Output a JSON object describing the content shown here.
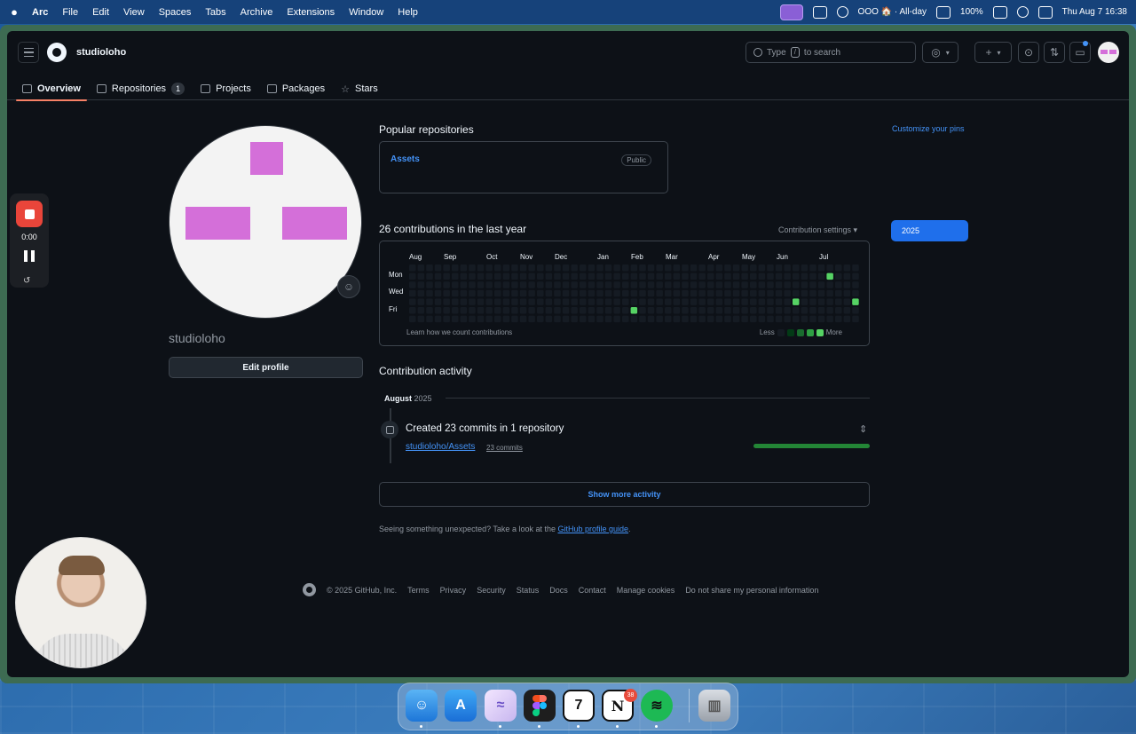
{
  "menubar": {
    "items": [
      "Arc",
      "File",
      "Edit",
      "View",
      "Spaces",
      "Tabs",
      "Archive",
      "Extensions",
      "Window",
      "Help"
    ],
    "status": "OOO 🏠 · All-day",
    "battery": "100%",
    "datetime": "Thu Aug 7  16:38"
  },
  "header": {
    "username": "studioloho",
    "search_prefix": "Type",
    "search_key": "/",
    "search_suffix": "to search",
    "plus": "+",
    "caret": "▾"
  },
  "tabs": [
    {
      "label": "Overview"
    },
    {
      "label": "Repositories",
      "count": "1"
    },
    {
      "label": "Projects"
    },
    {
      "label": "Packages"
    },
    {
      "label": "Stars"
    }
  ],
  "profile": {
    "name": "studioloho",
    "edit_label": "Edit profile",
    "emoji": "☺"
  },
  "popular": {
    "heading": "Popular repositories",
    "customize": "Customize your pins",
    "repo_name": "Assets",
    "repo_badge": "Public"
  },
  "contributions": {
    "title": "26 contributions in the last year",
    "settings": "Contribution settings ▾",
    "year": "2025",
    "months": [
      "Aug",
      "Sep",
      "Oct",
      "Nov",
      "Dec",
      "Jan",
      "Feb",
      "Mar",
      "Apr",
      "May",
      "Jun",
      "Jul"
    ],
    "days": [
      "Mon",
      "Wed",
      "Fri"
    ],
    "learn": "Learn how we count contributions",
    "less": "Less",
    "more": "More",
    "weeks": 53,
    "active_cells": [
      {
        "week": 26,
        "day": 5,
        "level": 3
      },
      {
        "week": 45,
        "day": 4,
        "level": 3
      },
      {
        "week": 49,
        "day": 1,
        "level": 3
      },
      {
        "week": 52,
        "day": 4,
        "level": 3
      }
    ],
    "colors": {
      "empty": "#151b23",
      "l1": "#033a16",
      "l2": "#196c2e",
      "l3": "#2ea043",
      "l4": "#56d364"
    }
  },
  "activity": {
    "title": "Contribution activity",
    "month": "August",
    "year": "2025",
    "created": "Created 23 commits in 1 repository",
    "repo_link": "studioloho/Assets",
    "commits": "23 commits",
    "progress": 1.0,
    "show_more": "Show more activity",
    "unexpected_prefix": "Seeing something unexpected? Take a look at the",
    "guide_link": "GitHub profile guide",
    "unexpected_suffix": "."
  },
  "footer": {
    "copyright": "© 2025 GitHub, Inc.",
    "links": [
      "Terms",
      "Privacy",
      "Security",
      "Status",
      "Docs",
      "Contact",
      "Manage cookies",
      "Do not share my personal information"
    ]
  },
  "recorder": {
    "time": "0:00"
  },
  "dock": {
    "notion_badge": "38"
  }
}
